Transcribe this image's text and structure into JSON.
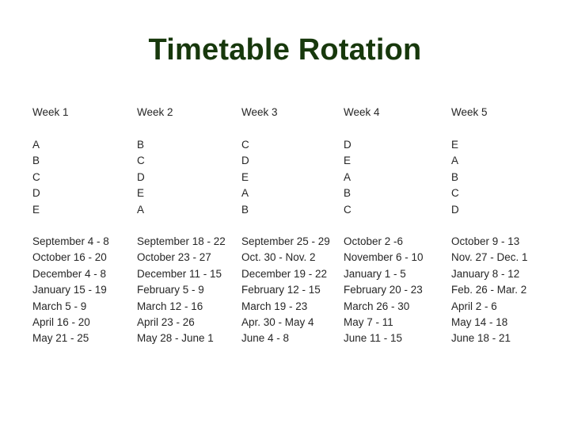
{
  "slide": {
    "title": "Timetable Rotation",
    "title_color": "#17380c",
    "text_color": "#262626",
    "background_color": "#ffffff"
  },
  "columns": [
    {
      "header": "Week 1",
      "letters": [
        "A",
        "B",
        "C",
        "D",
        "E"
      ],
      "dates": [
        "September 4 - 8",
        "October 16 - 20",
        "December 4 - 8",
        "January 15 - 19",
        "March 5 - 9",
        "April 16 - 20",
        "May 21 - 25"
      ]
    },
    {
      "header": "Week 2",
      "letters": [
        "B",
        "C",
        "D",
        "E",
        "A"
      ],
      "dates": [
        "September 18 - 22",
        "October 23 - 27",
        "December 11 - 15",
        "February 5 - 9",
        "March 12 - 16",
        "April 23 - 26",
        "May 28 - June 1"
      ]
    },
    {
      "header": "Week 3",
      "letters": [
        "C",
        "D",
        "E",
        "A",
        "B"
      ],
      "dates": [
        "September 25 - 29",
        "Oct. 30 - Nov. 2",
        "December 19 - 22",
        "February 12 - 15",
        "March 19 - 23",
        "Apr. 30 - May 4",
        "June 4 - 8"
      ]
    },
    {
      "header": "Week 4",
      "letters": [
        "D",
        "E",
        "A",
        "B",
        "C"
      ],
      "dates": [
        "October 2 -6",
        "November 6 - 10",
        "January 1 - 5",
        "February 20 - 23",
        "March 26 - 30",
        "May 7 - 11",
        "June 11 - 15"
      ]
    },
    {
      "header": "Week 5",
      "letters": [
        "E",
        "A",
        "B",
        "C",
        "D"
      ],
      "dates": [
        "October 9 - 13",
        "Nov. 27 - Dec. 1",
        "January 8 - 12",
        "Feb. 26 - Mar. 2",
        "April 2 - 6",
        "May 14 - 18",
        "June 18 - 21"
      ]
    }
  ]
}
